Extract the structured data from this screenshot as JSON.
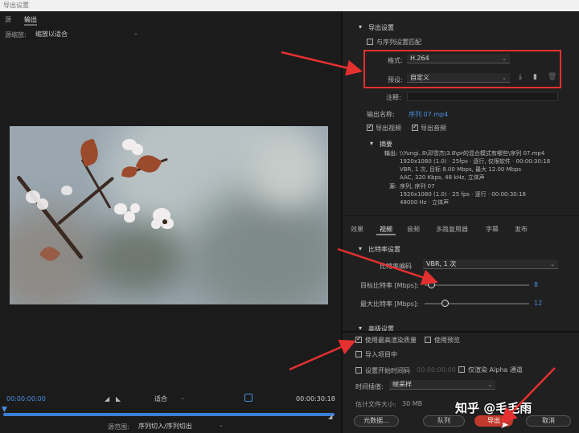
{
  "window": {
    "title": "导出设置"
  },
  "left": {
    "tabs": [
      "源",
      "输出"
    ],
    "scale_label": "源缩放:",
    "scale_value": "缩放以适合",
    "timeline": {
      "time_start": "00:00:00:00",
      "time_end": "00:00:30:18",
      "fit_value": "适合",
      "range_label": "源范围:",
      "range_value": "序列切入/序列切出"
    }
  },
  "right": {
    "export_section": "导出设置",
    "match_sequence": "与序列设置匹配",
    "format_label": "格式:",
    "format_value": "H.264",
    "preset_label": "预设:",
    "preset_value": "自定义",
    "comment_label": "注释:",
    "output_name_label": "输出名称:",
    "output_name_value": "序列 07.mp4",
    "export_video": "导出视频",
    "export_audio": "导出音频",
    "summary_head": "摘要",
    "summary_output_label": "输出:",
    "summary_output_lines": [
      "\\\\Yungi..8\\邓雪杰\\3.8\\pr的混合模式有哪些\\序列 07.mp4",
      "1920x1080 (1.0) · 25fps · 逐行, 仅限软件 · 00:00:30:18",
      "VBR, 1 次, 目标 8.00 Mbps, 最大 12.00 Mbps",
      "AAC, 320 Kbps, 48 kHz, 立体声"
    ],
    "summary_source_label": "源:",
    "summary_source_lines": [
      "序列, 序列 07",
      "1920x1080 (1.0) · 25 fps · 逐行 · 00:00:30:18",
      "48000 Hz · 立体声"
    ],
    "subtabs": [
      "效果",
      "视频",
      "音频",
      "多路复用器",
      "字幕",
      "发布"
    ],
    "bitrate_section": "比特率设置",
    "bitrate_encoding_label": "比特率编码",
    "bitrate_encoding_value": "VBR, 1 次",
    "target_bitrate_label": "目标比特率 [Mbps]:",
    "target_bitrate_value": "8",
    "target_bitrate_fraction": 0.07,
    "max_bitrate_label": "最大比特率 [Mbps]:",
    "max_bitrate_value": "12",
    "max_bitrate_fraction": 0.2,
    "advanced_section": "高级设置",
    "max_render_quality": "使用最高渲染质量",
    "use_preview": "使用预览",
    "import_project": "导入项目中",
    "set_start_timecode": "设置开始时间码",
    "start_timecode_value": "00:00:00:00",
    "render_alpha_only": "仅渲染 Alpha 通道",
    "time_interpolation_label": "时间插值:",
    "time_interpolation_value": "帧采样",
    "file_size_label": "估计文件大小:",
    "file_size_value": "30 MB",
    "metadata_button": "元数据...",
    "queue_button": "队列",
    "export_button": "导出",
    "cancel_button": "取消"
  },
  "watermark": "知乎 @毛毛雨",
  "colors": {
    "accent": "#4a8fe0",
    "annotation": "#e53030"
  }
}
